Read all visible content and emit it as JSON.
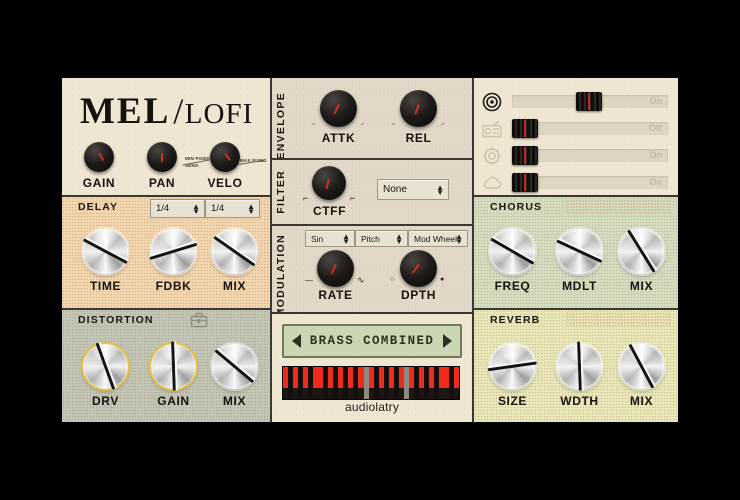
{
  "plugin": {
    "brand": "audiolatry",
    "logo": {
      "main": "MEL",
      "slash": "/",
      "sub": "LOFI"
    }
  },
  "header": {
    "knobs": [
      {
        "label": "GAIN",
        "angle": 150
      },
      {
        "label": "PAN",
        "angle": 180
      },
      {
        "label": "VELO",
        "angle": 145
      }
    ],
    "velo_scale": {
      "min": "MIN FIXED",
      "mid": "SENS",
      "max": "MAX FIXED"
    }
  },
  "settings": {
    "rows": [
      {
        "icon": "record-icon",
        "state": "On",
        "pos": 64
      },
      {
        "icon": "radio-icon",
        "state": "Off",
        "pos": 2
      },
      {
        "icon": "gear-icon",
        "state": "On",
        "pos": 2
      },
      {
        "icon": "cloud-icon",
        "state": "On",
        "pos": 2
      }
    ]
  },
  "delay": {
    "title": "DELAY",
    "selects": [
      {
        "value": "1/4"
      },
      {
        "value": "1/4"
      }
    ],
    "knobs": [
      {
        "label": "TIME",
        "angle": 118
      },
      {
        "label": "FDBK",
        "angle": 73
      },
      {
        "label": "MIX",
        "angle": 125
      }
    ]
  },
  "distortion": {
    "title": "DISTORTION",
    "icon": "toolbox-icon",
    "knobs": [
      {
        "label": "DRV",
        "angle": 160
      },
      {
        "label": "GAIN",
        "angle": 178
      },
      {
        "label": "MIX",
        "angle": 130
      }
    ]
  },
  "envelope": {
    "title": "ENVELOPE",
    "knobs": [
      {
        "label": "ATTK",
        "angle": 205
      },
      {
        "label": "REL",
        "angle": 200
      }
    ]
  },
  "filter": {
    "title": "FILTER",
    "knob": {
      "label": "CTFF",
      "angle": 195
    },
    "type": {
      "value": "None"
    }
  },
  "modulation": {
    "title": "MODULATION",
    "selects": [
      {
        "value": "Sin"
      },
      {
        "value": "Pitch"
      },
      {
        "value": "Mod Wheel"
      }
    ],
    "knobs": [
      {
        "label": "RATE",
        "angle": 205,
        "min": "—",
        "max": "∿"
      },
      {
        "label": "DPTH",
        "angle": 215,
        "min": "○",
        "max": "●"
      }
    ]
  },
  "chorus": {
    "title": "CHORUS",
    "knobs": [
      {
        "label": "FREQ",
        "angle": 120
      },
      {
        "label": "MDLT",
        "angle": 115
      },
      {
        "label": "MIX",
        "angle": 148
      }
    ]
  },
  "reverb": {
    "title": "REVERB",
    "knobs": [
      {
        "label": "SIZE",
        "angle": 82
      },
      {
        "label": "WDTH",
        "angle": 178
      },
      {
        "label": "MIX",
        "angle": 152
      }
    ]
  },
  "preset": {
    "name": "BRASS COMBINED",
    "prev": "◀",
    "next": "▶"
  },
  "keyboard": {
    "keys": [
      "lit",
      "dark",
      "lit",
      "dark",
      "lit",
      "dark",
      "lit",
      "lit",
      "dark",
      "lit",
      "dark",
      "lit",
      "dark",
      "lit",
      "dark",
      "lit",
      "gray",
      "lit",
      "dark",
      "lit",
      "dark",
      "lit",
      "dark",
      "lit",
      "gray",
      "lit",
      "dark",
      "lit",
      "dark",
      "lit",
      "dark",
      "lit",
      "lit",
      "dark",
      "lit"
    ]
  },
  "colors": {
    "accent_red": "#d52d1f",
    "gold_ring": "#e8c13e",
    "header_bg": "#efe6d2",
    "delay_bg": "#f3d5ad",
    "distortion_bg": "#c2c4b4",
    "chorus_bg": "#d4dcc0",
    "reverb_bg": "#e8e6b6",
    "center_bg": "#e0d7c6",
    "preset_bg": "#ccd6b4"
  }
}
